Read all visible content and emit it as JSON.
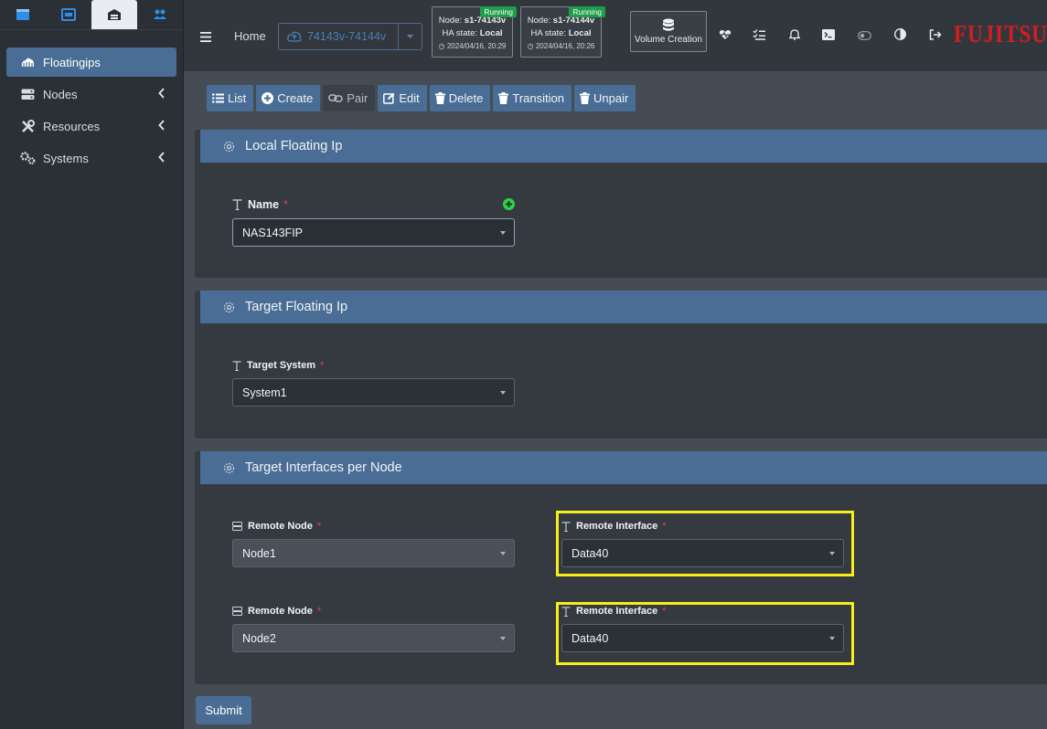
{
  "sidebar": {
    "tabs": [
      {
        "icon": "window-icon"
      },
      {
        "icon": "monitor-icon"
      },
      {
        "icon": "warehouse-icon"
      },
      {
        "icon": "users-icon"
      }
    ],
    "items": [
      {
        "label": "Floatingips",
        "icon": "cloud-icon"
      },
      {
        "label": "Nodes",
        "icon": "server-icon"
      },
      {
        "label": "Resources",
        "icon": "tools-icon"
      },
      {
        "label": "Systems",
        "icon": "gears-icon"
      }
    ]
  },
  "header": {
    "home_label": "Home",
    "cluster_value": "74143v-74144v",
    "nodes": [
      {
        "node_prefix": "Node: ",
        "node_name": "s1-74143v",
        "status": "Running",
        "ha_prefix": "HA state: ",
        "ha_state": "Local",
        "timestamp": "2024/04/16, 20:29"
      },
      {
        "node_prefix": "Node: ",
        "node_name": "s1-74144v",
        "status": "Running",
        "ha_prefix": "HA state: ",
        "ha_state": "Local",
        "timestamp": "2024/04/16, 20:26"
      }
    ],
    "volume_creation_label": "Volume Creation",
    "brand": "FUJITSU"
  },
  "toolbar": {
    "list": "List",
    "create": "Create",
    "pair": "Pair",
    "edit": "Edit",
    "delete": "Delete",
    "transition": "Transition",
    "unpair": "Unpair"
  },
  "local_panel": {
    "title": "Local Floating Ip",
    "name_label": "Name",
    "name_value": "NAS143FIP"
  },
  "target_panel": {
    "title": "Target Floating Ip",
    "system_label": "Target System",
    "system_value": "System1"
  },
  "interfaces_panel": {
    "title": "Target Interfaces per Node",
    "rows": [
      {
        "node_label": "Remote Node",
        "node_value": "Node1",
        "iface_label": "Remote Interface",
        "iface_value": "Data40"
      },
      {
        "node_label": "Remote Node",
        "node_value": "Node2",
        "iface_label": "Remote Interface",
        "iface_value": "Data40"
      }
    ]
  },
  "required_mark": "*",
  "submit_label": "Submit",
  "colors": {
    "accent": "#4a6d95",
    "highlight": "#f7ee1a",
    "running": "#1f9d4b",
    "brand": "#d21e1e"
  }
}
